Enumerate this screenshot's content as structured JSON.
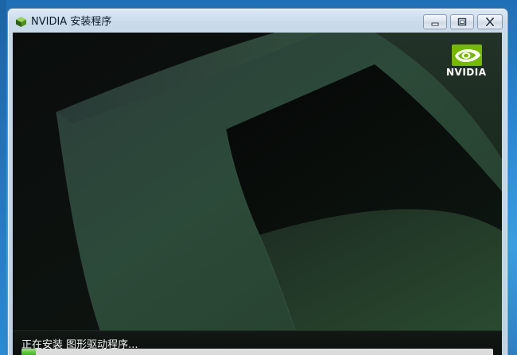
{
  "window": {
    "title": "NVIDIA 安装程序",
    "icon": "nvidia-cube-icon"
  },
  "caption_buttons": {
    "minimize_icon": "minimize-icon",
    "restore_icon": "restore-icon",
    "close_icon": "close-icon"
  },
  "logo": {
    "text": "NVIDIA",
    "icon": "nvidia-eye-icon",
    "accent_color": "#76b900"
  },
  "status": {
    "text": "正在安装 图形驱动程序..."
  },
  "progress": {
    "value": 0.03
  }
}
